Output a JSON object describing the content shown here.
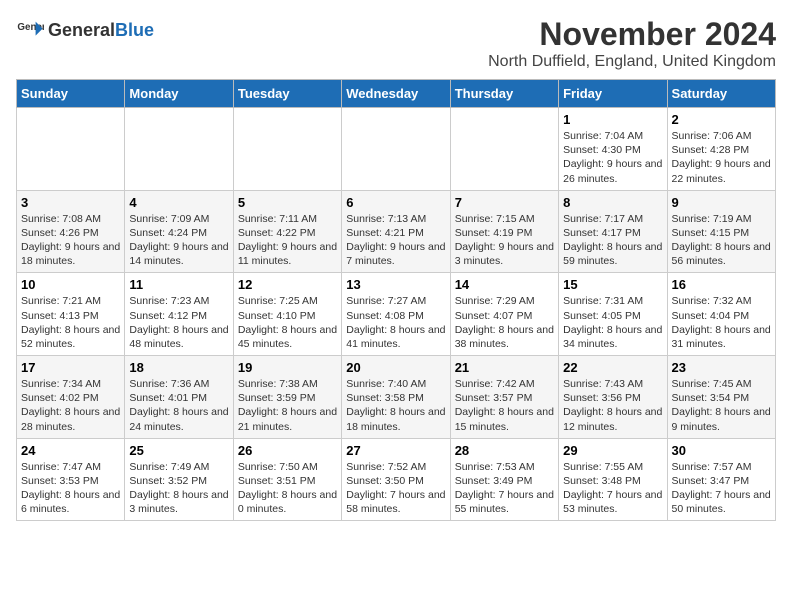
{
  "header": {
    "logo_general": "General",
    "logo_blue": "Blue",
    "main_title": "November 2024",
    "sub_title": "North Duffield, England, United Kingdom"
  },
  "days_of_week": [
    "Sunday",
    "Monday",
    "Tuesday",
    "Wednesday",
    "Thursday",
    "Friday",
    "Saturday"
  ],
  "weeks": [
    [
      {
        "day": "",
        "info": ""
      },
      {
        "day": "",
        "info": ""
      },
      {
        "day": "",
        "info": ""
      },
      {
        "day": "",
        "info": ""
      },
      {
        "day": "",
        "info": ""
      },
      {
        "day": "1",
        "info": "Sunrise: 7:04 AM\nSunset: 4:30 PM\nDaylight: 9 hours and 26 minutes."
      },
      {
        "day": "2",
        "info": "Sunrise: 7:06 AM\nSunset: 4:28 PM\nDaylight: 9 hours and 22 minutes."
      }
    ],
    [
      {
        "day": "3",
        "info": "Sunrise: 7:08 AM\nSunset: 4:26 PM\nDaylight: 9 hours and 18 minutes."
      },
      {
        "day": "4",
        "info": "Sunrise: 7:09 AM\nSunset: 4:24 PM\nDaylight: 9 hours and 14 minutes."
      },
      {
        "day": "5",
        "info": "Sunrise: 7:11 AM\nSunset: 4:22 PM\nDaylight: 9 hours and 11 minutes."
      },
      {
        "day": "6",
        "info": "Sunrise: 7:13 AM\nSunset: 4:21 PM\nDaylight: 9 hours and 7 minutes."
      },
      {
        "day": "7",
        "info": "Sunrise: 7:15 AM\nSunset: 4:19 PM\nDaylight: 9 hours and 3 minutes."
      },
      {
        "day": "8",
        "info": "Sunrise: 7:17 AM\nSunset: 4:17 PM\nDaylight: 8 hours and 59 minutes."
      },
      {
        "day": "9",
        "info": "Sunrise: 7:19 AM\nSunset: 4:15 PM\nDaylight: 8 hours and 56 minutes."
      }
    ],
    [
      {
        "day": "10",
        "info": "Sunrise: 7:21 AM\nSunset: 4:13 PM\nDaylight: 8 hours and 52 minutes."
      },
      {
        "day": "11",
        "info": "Sunrise: 7:23 AM\nSunset: 4:12 PM\nDaylight: 8 hours and 48 minutes."
      },
      {
        "day": "12",
        "info": "Sunrise: 7:25 AM\nSunset: 4:10 PM\nDaylight: 8 hours and 45 minutes."
      },
      {
        "day": "13",
        "info": "Sunrise: 7:27 AM\nSunset: 4:08 PM\nDaylight: 8 hours and 41 minutes."
      },
      {
        "day": "14",
        "info": "Sunrise: 7:29 AM\nSunset: 4:07 PM\nDaylight: 8 hours and 38 minutes."
      },
      {
        "day": "15",
        "info": "Sunrise: 7:31 AM\nSunset: 4:05 PM\nDaylight: 8 hours and 34 minutes."
      },
      {
        "day": "16",
        "info": "Sunrise: 7:32 AM\nSunset: 4:04 PM\nDaylight: 8 hours and 31 minutes."
      }
    ],
    [
      {
        "day": "17",
        "info": "Sunrise: 7:34 AM\nSunset: 4:02 PM\nDaylight: 8 hours and 28 minutes."
      },
      {
        "day": "18",
        "info": "Sunrise: 7:36 AM\nSunset: 4:01 PM\nDaylight: 8 hours and 24 minutes."
      },
      {
        "day": "19",
        "info": "Sunrise: 7:38 AM\nSunset: 3:59 PM\nDaylight: 8 hours and 21 minutes."
      },
      {
        "day": "20",
        "info": "Sunrise: 7:40 AM\nSunset: 3:58 PM\nDaylight: 8 hours and 18 minutes."
      },
      {
        "day": "21",
        "info": "Sunrise: 7:42 AM\nSunset: 3:57 PM\nDaylight: 8 hours and 15 minutes."
      },
      {
        "day": "22",
        "info": "Sunrise: 7:43 AM\nSunset: 3:56 PM\nDaylight: 8 hours and 12 minutes."
      },
      {
        "day": "23",
        "info": "Sunrise: 7:45 AM\nSunset: 3:54 PM\nDaylight: 8 hours and 9 minutes."
      }
    ],
    [
      {
        "day": "24",
        "info": "Sunrise: 7:47 AM\nSunset: 3:53 PM\nDaylight: 8 hours and 6 minutes."
      },
      {
        "day": "25",
        "info": "Sunrise: 7:49 AM\nSunset: 3:52 PM\nDaylight: 8 hours and 3 minutes."
      },
      {
        "day": "26",
        "info": "Sunrise: 7:50 AM\nSunset: 3:51 PM\nDaylight: 8 hours and 0 minutes."
      },
      {
        "day": "27",
        "info": "Sunrise: 7:52 AM\nSunset: 3:50 PM\nDaylight: 7 hours and 58 minutes."
      },
      {
        "day": "28",
        "info": "Sunrise: 7:53 AM\nSunset: 3:49 PM\nDaylight: 7 hours and 55 minutes."
      },
      {
        "day": "29",
        "info": "Sunrise: 7:55 AM\nSunset: 3:48 PM\nDaylight: 7 hours and 53 minutes."
      },
      {
        "day": "30",
        "info": "Sunrise: 7:57 AM\nSunset: 3:47 PM\nDaylight: 7 hours and 50 minutes."
      }
    ]
  ]
}
